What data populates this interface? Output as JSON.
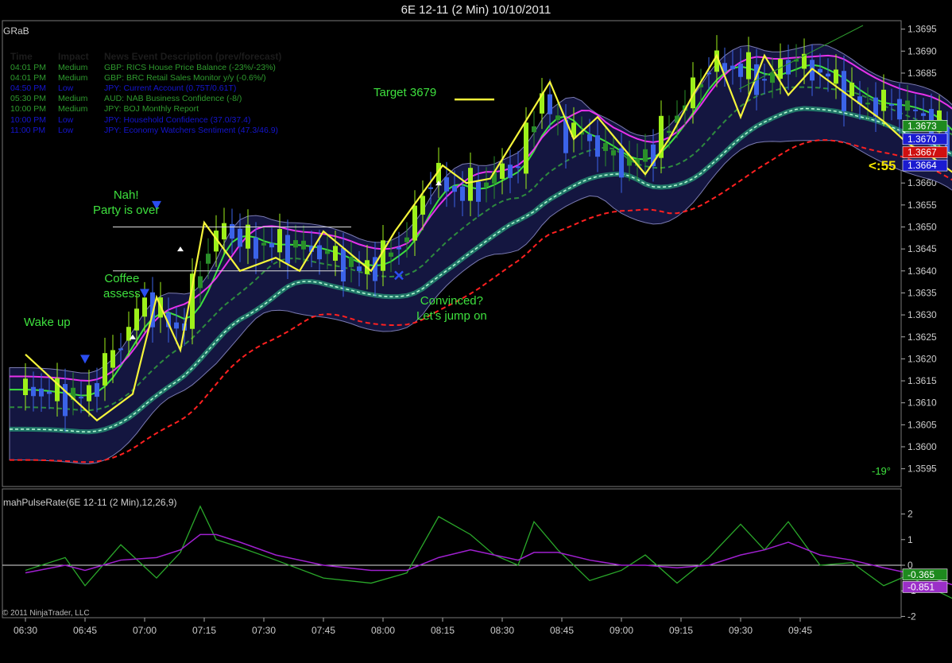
{
  "window": {
    "title": "6E 12-11 (2 Min)  10/10/2011"
  },
  "price_panel": {
    "indicator_label": "GRaB"
  },
  "sub_panel": {
    "indicator_label": "mahPulseRate(6E 12-11 (2 Min),12,26,9)"
  },
  "footer": {
    "copyright": "© 2011 NinjaTrader, LLC"
  },
  "news": {
    "headers": {
      "time": "Time",
      "impact": "Impact",
      "description": "News Event Description (prev/forecast)"
    },
    "rows": [
      {
        "time": "04:01 PM",
        "impact": "Medium",
        "description": "GBP: RICS House Price Balance (-23%/-23%)",
        "color": "#2e9a2e"
      },
      {
        "time": "04:01 PM",
        "impact": "Medium",
        "description": "GBP: BRC Retail Sales Monitor y/y (-0.6%/)",
        "color": "#2e9a2e"
      },
      {
        "time": "04:50 PM",
        "impact": "Low",
        "description": "JPY: Current Account (0.75T/0.61T)",
        "color": "#1515d0"
      },
      {
        "time": "05:30 PM",
        "impact": "Medium",
        "description": "AUD: NAB Business Confidence (-8/)",
        "color": "#2e9a2e"
      },
      {
        "time": "10:00 PM",
        "impact": "Medium",
        "description": "JPY: BOJ Monthly Report",
        "color": "#2e9a2e"
      },
      {
        "time": "10:00 PM",
        "impact": "Low",
        "description": "JPY: Household Confidence (37.0/37.4)",
        "color": "#1515d0"
      },
      {
        "time": "11:00 PM",
        "impact": "Low",
        "description": "JPY: Economy Watchers Sentiment (47.3/46.9)",
        "color": "#1515d0"
      }
    ]
  },
  "annotations": {
    "wake_up": "Wake up",
    "coffee_line1": "Coffee",
    "coffee_line2": "assess",
    "nah_line1": "Nah!",
    "nah_line2": "Party is over",
    "target": "Target 3679",
    "convinced_line1": "Convinced?",
    "convinced_line2": "Let's jump on"
  },
  "bar_timer": "<:55",
  "trend_angle": "-19°",
  "colors": {
    "bull": "#9ef01a",
    "bull_dark": "#2a8f2a",
    "bear_blue": "#3b63e8",
    "bear_red": "#f02a2a",
    "zigzag": "#f5f53a",
    "ema_fast": "#3ee03e",
    "ema_slow": "#ff35ff",
    "band": "#141640",
    "channel": "#2ec88a",
    "red_dash": "#ff2020"
  },
  "chart_data": {
    "type": "candlestick",
    "symbol": "6E 12-11",
    "interval": "2 Min",
    "date": "10/10/2011",
    "x_tick_labels": [
      "06:30",
      "06:45",
      "07:00",
      "07:15",
      "07:30",
      "07:45",
      "08:00",
      "08:15",
      "08:30",
      "08:45",
      "09:00",
      "09:15",
      "09:30",
      "09:45"
    ],
    "y_tick_labels": [
      "1.3595",
      "1.3600",
      "1.3605",
      "1.3610",
      "1.3615",
      "1.3620",
      "1.3625",
      "1.3630",
      "1.3635",
      "1.3640",
      "1.3645",
      "1.3650",
      "1.3655",
      "1.3660",
      "1.3665",
      "1.3670",
      "1.3675",
      "1.3680",
      "1.3685",
      "1.3690",
      "1.3695"
    ],
    "ylim": [
      1.3591,
      1.3697
    ],
    "price_series_minutes": [
      0,
      15,
      30,
      39,
      45,
      50,
      56,
      63,
      66,
      72,
      78,
      84,
      90,
      96,
      102,
      108,
      114,
      120,
      124,
      128,
      130,
      134,
      140,
      146,
      152,
      158,
      164,
      168,
      172,
      180,
      186,
      192,
      198,
      204,
      210,
      216,
      222,
      228,
      234,
      236,
      240,
      244,
      248,
      252,
      256,
      258
    ],
    "price_series_close": [
      1.3613,
      1.3611,
      1.3633,
      1.3626,
      1.3644,
      1.365,
      1.3646,
      1.3646,
      1.3646,
      1.3645,
      1.3643,
      1.364,
      1.3643,
      1.3648,
      1.3662,
      1.3658,
      1.3659,
      1.3663,
      1.3664,
      1.3676,
      1.368,
      1.3672,
      1.3671,
      1.3667,
      1.3664,
      1.3668,
      1.3676,
      1.3681,
      1.3687,
      1.3686,
      1.3683,
      1.3688,
      1.3686,
      1.3683,
      1.3678,
      1.3678,
      1.3677,
      1.3674,
      1.3667,
      1.3666,
      1.3664,
      1.3665,
      1.3664,
      1.3664,
      1.3665,
      1.3664
    ],
    "price_markers": [
      {
        "label": "1.3673",
        "value": 1.3673,
        "color": "#1e8a1e"
      },
      {
        "label": "1.3670",
        "value": 1.367,
        "color": "#1b1bd0"
      },
      {
        "label": "1.3667",
        "value": 1.3667,
        "color": "#d01010"
      },
      {
        "label": "1.3664",
        "value": 1.3664,
        "color": "#1b1bd0"
      }
    ],
    "zigzag_minutes": [
      0,
      18,
      27,
      33,
      39,
      45,
      54,
      63,
      69,
      75,
      87,
      93,
      105,
      111,
      117,
      132,
      138,
      144,
      156,
      162,
      168,
      174,
      180,
      186,
      192,
      198,
      210,
      216,
      222,
      228,
      234,
      240,
      246
    ],
    "zigzag_values": [
      1.3621,
      1.3606,
      1.3612,
      1.3634,
      1.3622,
      1.3651,
      1.364,
      1.3643,
      1.364,
      1.3649,
      1.364,
      1.3649,
      1.3664,
      1.366,
      1.3661,
      1.3683,
      1.367,
      1.3675,
      1.3662,
      1.367,
      1.368,
      1.3689,
      1.3675,
      1.3689,
      1.368,
      1.3686,
      1.3678,
      1.3674,
      1.3669,
      1.3666,
      1.3662,
      1.366,
      1.3662
    ],
    "target_value": 1.3679,
    "subpanel": {
      "name": "mahPulseRate(6E 12-11 (2 Min),12,26,9)",
      "ylim": [
        -2.3,
        2.9
      ],
      "y_tick_labels": [
        "-2",
        "-1",
        "0",
        "1",
        "2"
      ],
      "minutes": [
        0,
        10,
        15,
        24,
        33,
        39,
        44,
        48,
        54,
        63,
        75,
        87,
        96,
        104,
        112,
        118,
        124,
        128,
        134,
        142,
        150,
        156,
        164,
        172,
        180,
        186,
        192,
        200,
        208,
        216,
        222,
        228,
        236,
        242,
        250,
        256
      ],
      "line_values": [
        -0.2,
        0.3,
        -0.8,
        0.8,
        -0.5,
        0.5,
        2.3,
        1.0,
        0.7,
        0.2,
        -0.5,
        -0.7,
        -0.3,
        1.9,
        1.2,
        0.4,
        0.0,
        1.7,
        0.6,
        -0.6,
        -0.2,
        0.4,
        -0.7,
        0.3,
        1.6,
        0.6,
        1.7,
        0.0,
        0.1,
        -0.8,
        -0.4,
        -0.9,
        -1.5,
        -1.2,
        -0.7,
        -0.365
      ],
      "signal_values": [
        -0.3,
        0.0,
        -0.2,
        0.2,
        0.3,
        0.6,
        1.2,
        1.2,
        0.9,
        0.4,
        0.0,
        -0.2,
        -0.2,
        0.3,
        0.6,
        0.4,
        0.2,
        0.5,
        0.5,
        0.2,
        0.0,
        0.0,
        -0.1,
        0.0,
        0.4,
        0.6,
        0.9,
        0.4,
        0.2,
        -0.1,
        -0.3,
        -0.5,
        -0.9,
        -1.0,
        -0.9,
        -0.851
      ],
      "markers": [
        {
          "label": "-0.365",
          "value": -0.365,
          "color": "#1e8a1e"
        },
        {
          "label": "-0.851",
          "value": -0.851,
          "color": "#9b2fc8"
        }
      ]
    }
  }
}
